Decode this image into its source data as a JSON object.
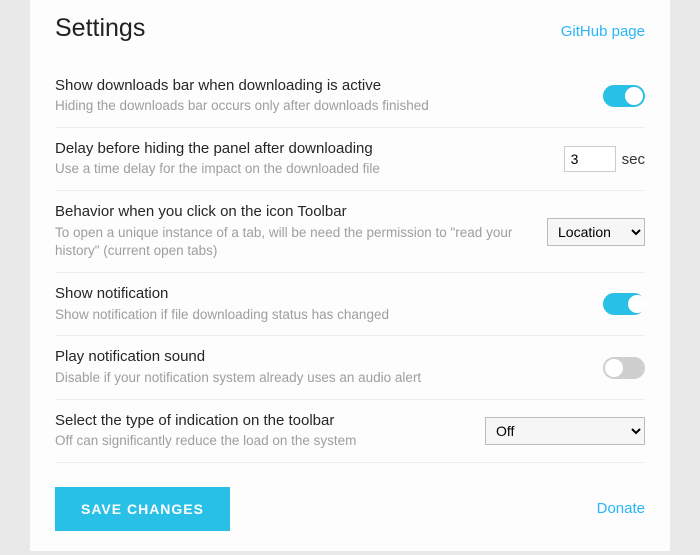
{
  "header": {
    "title": "Settings",
    "github_link": "GitHub page"
  },
  "rows": {
    "show_bar": {
      "label": "Show downloads bar when downloading is active",
      "desc": "Hiding the downloads bar occurs only after downloads finished",
      "value": true
    },
    "delay": {
      "label": "Delay before hiding the panel after downloading",
      "desc": "Use a time delay for the impact on the downloaded file",
      "value": "3",
      "unit": "sec"
    },
    "behavior": {
      "label": "Behavior when you click on the icon Toolbar",
      "desc": "To open a unique instance of a tab, will be need the permission to \"read your history\" (current open tabs)",
      "value": "Location"
    },
    "notification": {
      "label": "Show notification",
      "desc": "Show notification if file downloading status has changed",
      "value": true
    },
    "sound": {
      "label": "Play notification sound",
      "desc": "Disable if your notification system already uses an audio alert",
      "value": false
    },
    "indication": {
      "label": "Select the type of indication on the toolbar",
      "desc": "Off can significantly reduce the load on the system",
      "value": "Off"
    }
  },
  "footer": {
    "save": "SAVE CHANGES",
    "donate": "Donate"
  }
}
